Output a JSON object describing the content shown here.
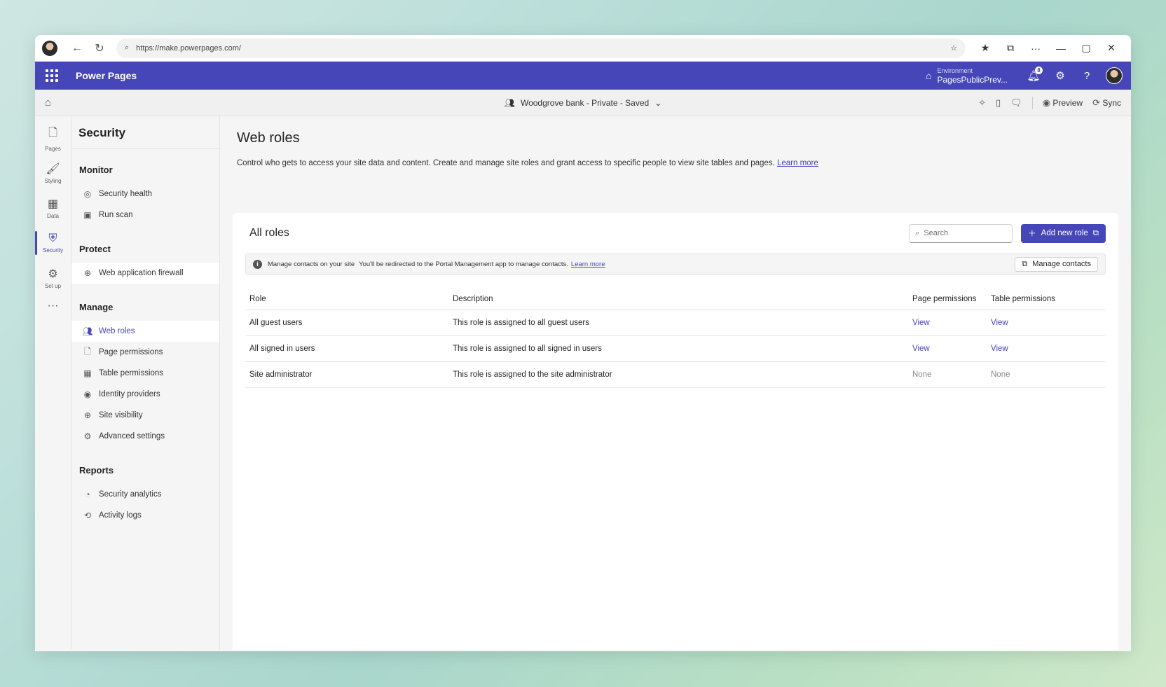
{
  "browser": {
    "url": "https://make.powerpages.com/",
    "back_icon": "←",
    "refresh_icon": "↻",
    "controls": [
      "☆",
      "★",
      "⧉",
      "···",
      "—",
      "▢",
      "✕"
    ]
  },
  "app": {
    "name": "Power Pages",
    "env_label": "Environment",
    "env_name": "PagesPublicPrev...",
    "notification_count": "8"
  },
  "command_bar": {
    "site": "Woodgrove bank - Private - Saved",
    "preview": "Preview",
    "sync": "Sync"
  },
  "rail": [
    {
      "label": "Pages",
      "icon": "🗋"
    },
    {
      "label": "Styling",
      "icon": "🖌"
    },
    {
      "label": "Data",
      "icon": "▦"
    },
    {
      "label": "Security",
      "icon": "⛨"
    },
    {
      "label": "Set up",
      "icon": "⚙"
    }
  ],
  "sidenav": {
    "title": "Security",
    "groups": [
      {
        "title": "Monitor",
        "items": [
          "Security health",
          "Run scan"
        ]
      },
      {
        "title": "Protect",
        "items": [
          "Web application firewall"
        ]
      },
      {
        "title": "Manage",
        "items": [
          "Web roles",
          "Page permissions",
          "Table permissions",
          "Identity providers",
          "Site visibility",
          "Advanced settings"
        ]
      },
      {
        "title": "Reports",
        "items": [
          "Security analytics",
          "Activity logs"
        ]
      }
    ]
  },
  "main": {
    "title": "Web roles",
    "description": "Control who gets to access your site data and content. Create and manage site roles and grant access to specific people to view site tables and pages.",
    "learn_more": "Learn more",
    "card": {
      "title": "All roles",
      "search_placeholder": "Search",
      "add_button": "Add new role",
      "info_title": "Manage contacts on your site",
      "info_text": "You'll be redirected to the Portal Management app to manage contacts.",
      "info_link": "Learn more",
      "manage_contacts": "Manage contacts"
    },
    "table": {
      "columns": [
        "Role",
        "Description",
        "Page permissions",
        "Table permissions"
      ],
      "rows": [
        {
          "role": "All guest users",
          "description": "This role is assigned to all guest users",
          "page": "View",
          "table": "View"
        },
        {
          "role": "All signed in users",
          "description": "This role is assigned to all signed in users",
          "page": "View",
          "table": "View"
        },
        {
          "role": "Site administrator",
          "description": "This role is assigned to the site administrator",
          "page": "None",
          "table": "None"
        }
      ]
    }
  }
}
